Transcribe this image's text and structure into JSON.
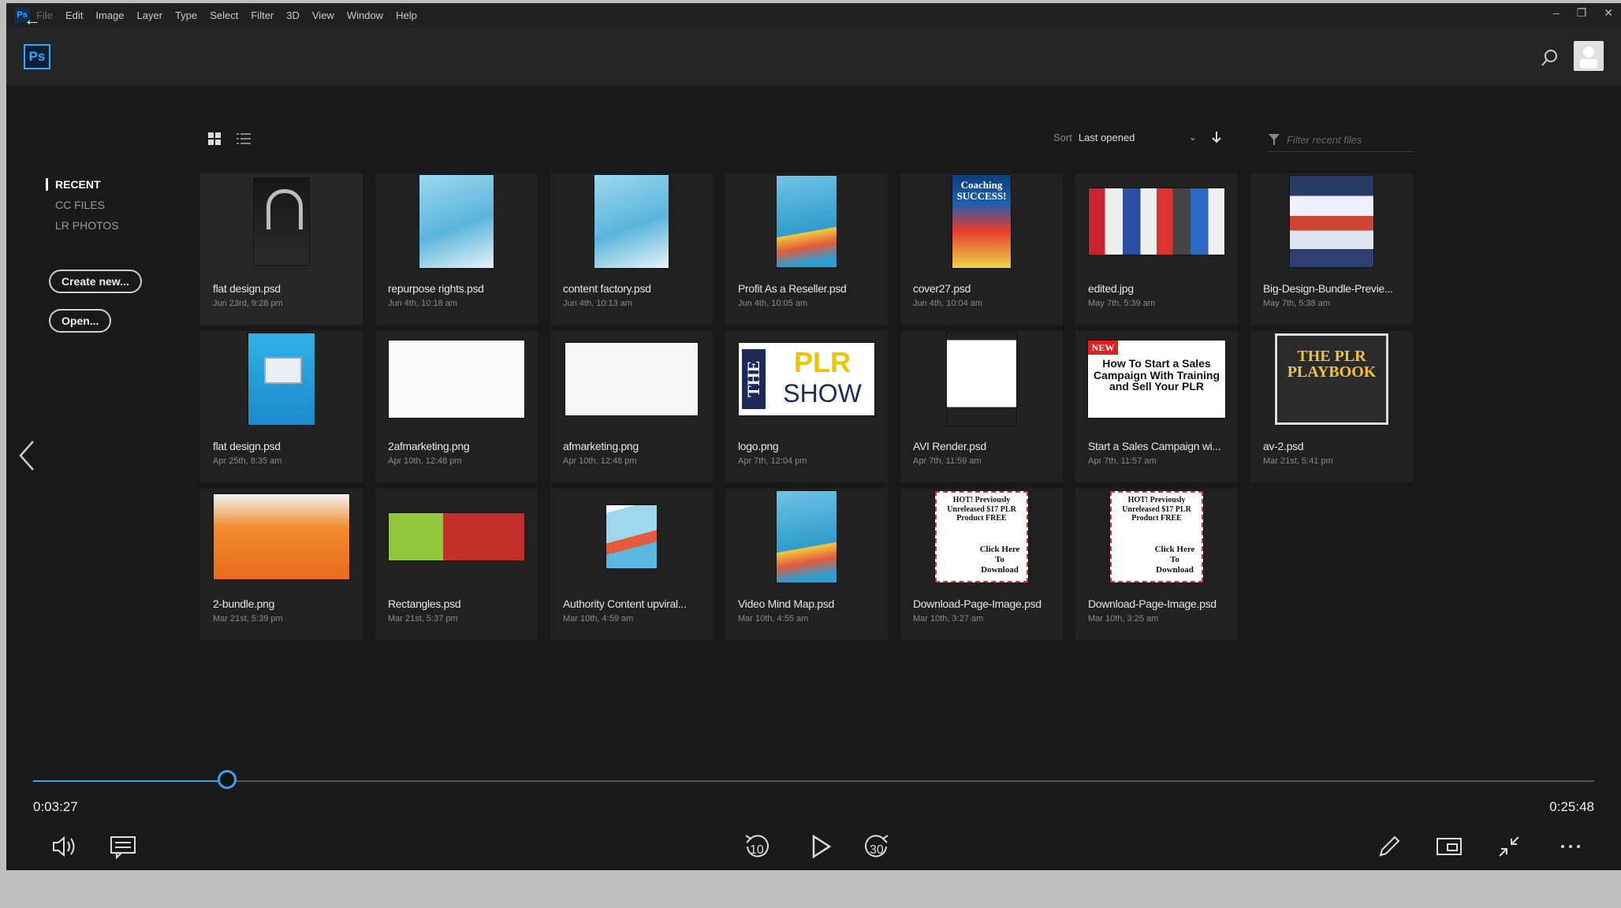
{
  "menubar": {
    "app_icon_text": "Ps",
    "items": [
      "File",
      "Edit",
      "Image",
      "Layer",
      "Type",
      "Select",
      "Filter",
      "3D",
      "View",
      "Window",
      "Help"
    ],
    "window_controls": [
      "–",
      "❐",
      "✕"
    ]
  },
  "header": {
    "logo_text": "Ps",
    "icons": [
      "back-arrow-icon",
      "search-icon",
      "user-avatar"
    ]
  },
  "sidebar": {
    "nav": [
      "RECENT",
      "CC FILES",
      "LR PHOTOS"
    ],
    "active": "RECENT",
    "create_label": "Create new...",
    "open_label": "Open..."
  },
  "toolbar": {
    "sort_label": "Sort",
    "sort_value": "Last opened",
    "filter_placeholder": "Filter recent files",
    "view_icons": [
      "grid-view-icon",
      "list-view-icon"
    ]
  },
  "files": [
    {
      "name": "flat design.psd",
      "date": "Jun 23rd, 9:28 pm"
    },
    {
      "name": "repurpose rights.psd",
      "date": "Jun 4th, 10:18 am"
    },
    {
      "name": "content factory.psd",
      "date": "Jun 4th, 10:13 am"
    },
    {
      "name": "Profit As a Reseller.psd",
      "date": "Jun 4th, 10:05 am"
    },
    {
      "name": "cover27.psd",
      "date": "Jun 4th, 10:04 am"
    },
    {
      "name": "edited.jpg",
      "date": "May 7th, 5:39 am"
    },
    {
      "name": "Big-Design-Bundle-Previe...",
      "date": "May 7th, 5:38 am"
    },
    {
      "name": "flat design.psd",
      "date": "Apr 25th, 8:35 am"
    },
    {
      "name": "2afmarketing.png",
      "date": "Apr 10th, 12:48 pm"
    },
    {
      "name": "afmarketing.png",
      "date": "Apr 10th, 12:48 pm"
    },
    {
      "name": "logo.png",
      "date": "Apr 7th, 12:04 pm"
    },
    {
      "name": "AVI Render.psd",
      "date": "Apr 7th, 11:59 am"
    },
    {
      "name": "Start a Sales Campaign wi...",
      "date": "Apr 7th, 11:57 am"
    },
    {
      "name": "av-2.psd",
      "date": "Mar 21st, 5:41 pm"
    },
    {
      "name": "2-bundle.png",
      "date": "Mar 21st, 5:39 pm"
    },
    {
      "name": "Rectangles.psd",
      "date": "Mar 21st, 5:37 pm"
    },
    {
      "name": "Authority Content upviral...",
      "date": "Mar 10th, 4:59 am"
    },
    {
      "name": "Video Mind Map.psd",
      "date": "Mar 10th, 4:55 am"
    },
    {
      "name": "Download-Page-Image.psd",
      "date": "Mar 10th, 3:27 am"
    },
    {
      "name": "Download-Page-Image.psd",
      "date": "Mar 10th, 3:25 am"
    }
  ],
  "thumb_text": {
    "coaching": "Coaching SUCCESS!",
    "logo_the": "THE",
    "logo_plr": "PLR",
    "logo_show": "SHOW",
    "sales_lines": "How To Start a Sales Campaign With Training and Sell Your PLR",
    "sales_badge": "NEW",
    "plr_title": "THE PLR PLAYBOOK",
    "flyer_lines": "HOT! Previously Unreleased $17 PLR Product FREE",
    "flyer_cta": "Click Here To Download"
  },
  "player": {
    "current_time": "0:03:27",
    "total_time": "0:25:48",
    "progress": 0.124,
    "skip_back": "10",
    "skip_forward": "30",
    "accent": "#3aa0f0"
  }
}
